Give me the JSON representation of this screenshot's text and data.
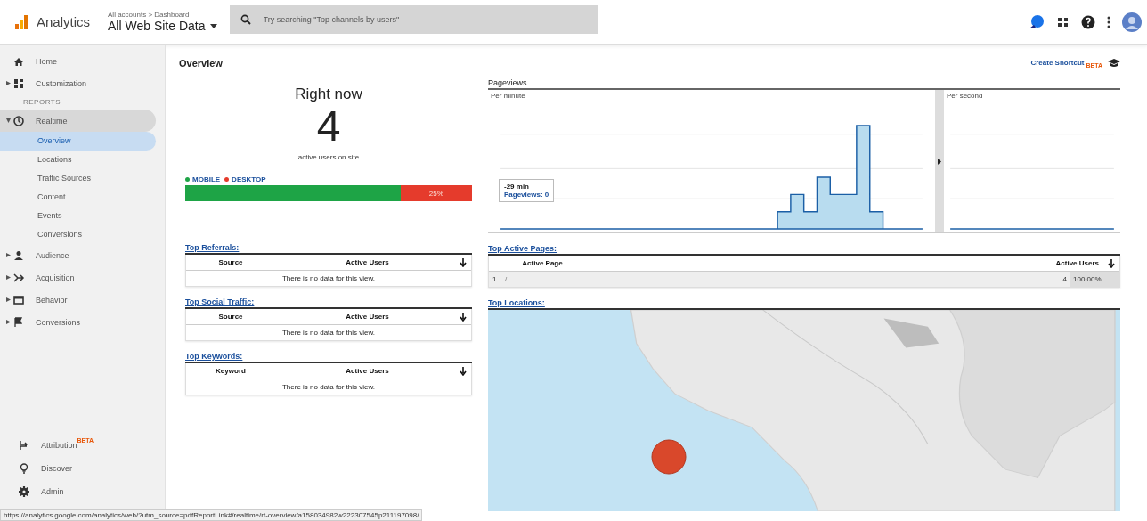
{
  "header": {
    "logo_text": "Analytics",
    "breadcrumb": "All accounts > Dashboard",
    "property": "All Web Site Data",
    "search_placeholder": "Try searching \"Top channels by users\""
  },
  "sidebar": {
    "top_items": [
      {
        "label": "Home",
        "expandable": false
      },
      {
        "label": "Customization",
        "expandable": true
      }
    ],
    "section_label": "REPORTS",
    "reports": [
      {
        "label": "Realtime",
        "expanded": true,
        "children": [
          {
            "label": "Overview",
            "selected": true
          },
          {
            "label": "Locations",
            "selected": false
          },
          {
            "label": "Traffic Sources",
            "selected": false
          },
          {
            "label": "Content",
            "selected": false
          },
          {
            "label": "Events",
            "selected": false
          },
          {
            "label": "Conversions",
            "selected": false
          }
        ]
      },
      {
        "label": "Audience",
        "expanded": false
      },
      {
        "label": "Acquisition",
        "expanded": false
      },
      {
        "label": "Behavior",
        "expanded": false
      },
      {
        "label": "Conversions",
        "expanded": false
      }
    ],
    "bottom_items": [
      {
        "label": "Attribution",
        "badge": "BETA"
      },
      {
        "label": "Discover"
      },
      {
        "label": "Admin"
      }
    ]
  },
  "page": {
    "title": "Overview",
    "shortcut": "Create Shortcut",
    "shortcut_badge": "BETA"
  },
  "right_now": {
    "title": "Right now",
    "count": "4",
    "caption": "active users on site",
    "devices": [
      {
        "label": "MOBILE",
        "color": "#1ea446",
        "level": 0.75
      },
      {
        "label": "DESKTOP",
        "color": "#e53b2c",
        "level": 0.25,
        "value_label": "25%"
      }
    ]
  },
  "pageviews": {
    "title": "Pageviews",
    "per_minute": "Per minute",
    "per_second": "Per second",
    "tooltip": {
      "time": "-29 min",
      "series": "Pageviews: 0"
    }
  },
  "referrals": {
    "title": "Top Referrals:",
    "columns": [
      "Source",
      "Active Users"
    ],
    "empty_text": "There is no data for this view."
  },
  "social": {
    "title": "Top Social Traffic:",
    "columns": [
      "Source",
      "Active Users"
    ],
    "empty_text": "There is no data for this view."
  },
  "keywords": {
    "title": "Top Keywords:",
    "columns": [
      "Keyword",
      "Active Users"
    ],
    "empty_text": "There is no data for this view."
  },
  "active_pages": {
    "title": "Top Active Pages:",
    "columns": [
      "Active Page",
      "Active Users"
    ],
    "rows": [
      {
        "rank": "1.",
        "page": "/",
        "users": "4",
        "percent": "100.00%"
      }
    ]
  },
  "locations": {
    "title": "Top Locations:"
  },
  "status_url": "https://analytics.google.com/analytics/web/?utm_source=pdfReportLink#/realtime/rt-overview/a158034982w222307545p211197098/"
}
